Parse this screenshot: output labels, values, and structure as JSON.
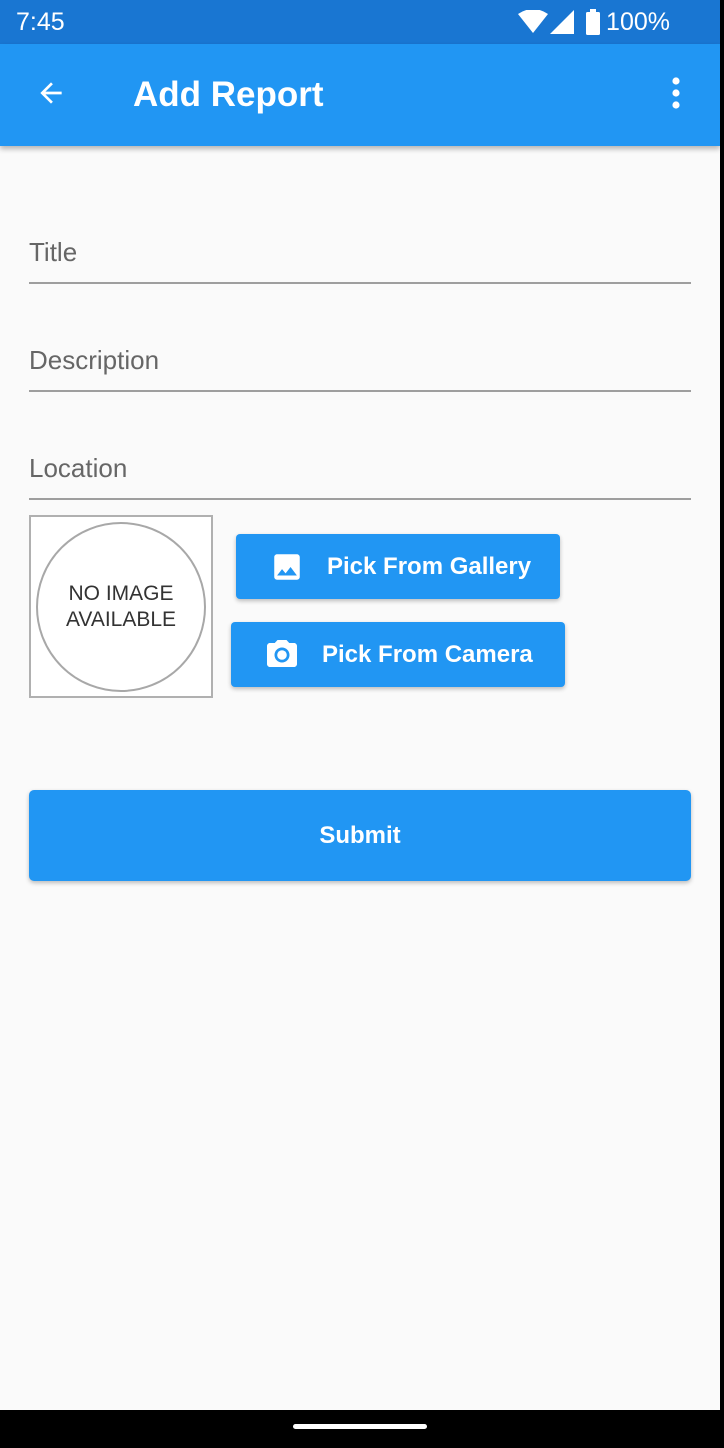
{
  "status_bar": {
    "time": "7:45",
    "battery": "100%",
    "icons": [
      "wifi-icon",
      "cell-signal-icon",
      "battery-icon"
    ]
  },
  "app_bar": {
    "title": "Add Report",
    "back_icon": "arrow-back-icon",
    "menu_icon": "more-vert-icon"
  },
  "form": {
    "title": {
      "placeholder": "Title",
      "value": ""
    },
    "description": {
      "placeholder": "Description",
      "value": ""
    },
    "location": {
      "placeholder": "Location",
      "value": ""
    }
  },
  "image": {
    "line1": "NO IMAGE",
    "line2": "AVAILABLE"
  },
  "buttons": {
    "gallery": {
      "label": "Pick From Gallery",
      "icon": "image-icon"
    },
    "camera": {
      "label": "Pick From Camera",
      "icon": "camera-icon"
    },
    "submit": "Submit"
  },
  "colors": {
    "primary": "#2196f3",
    "primary_dark": "#1976d2",
    "background": "#fafafa"
  }
}
